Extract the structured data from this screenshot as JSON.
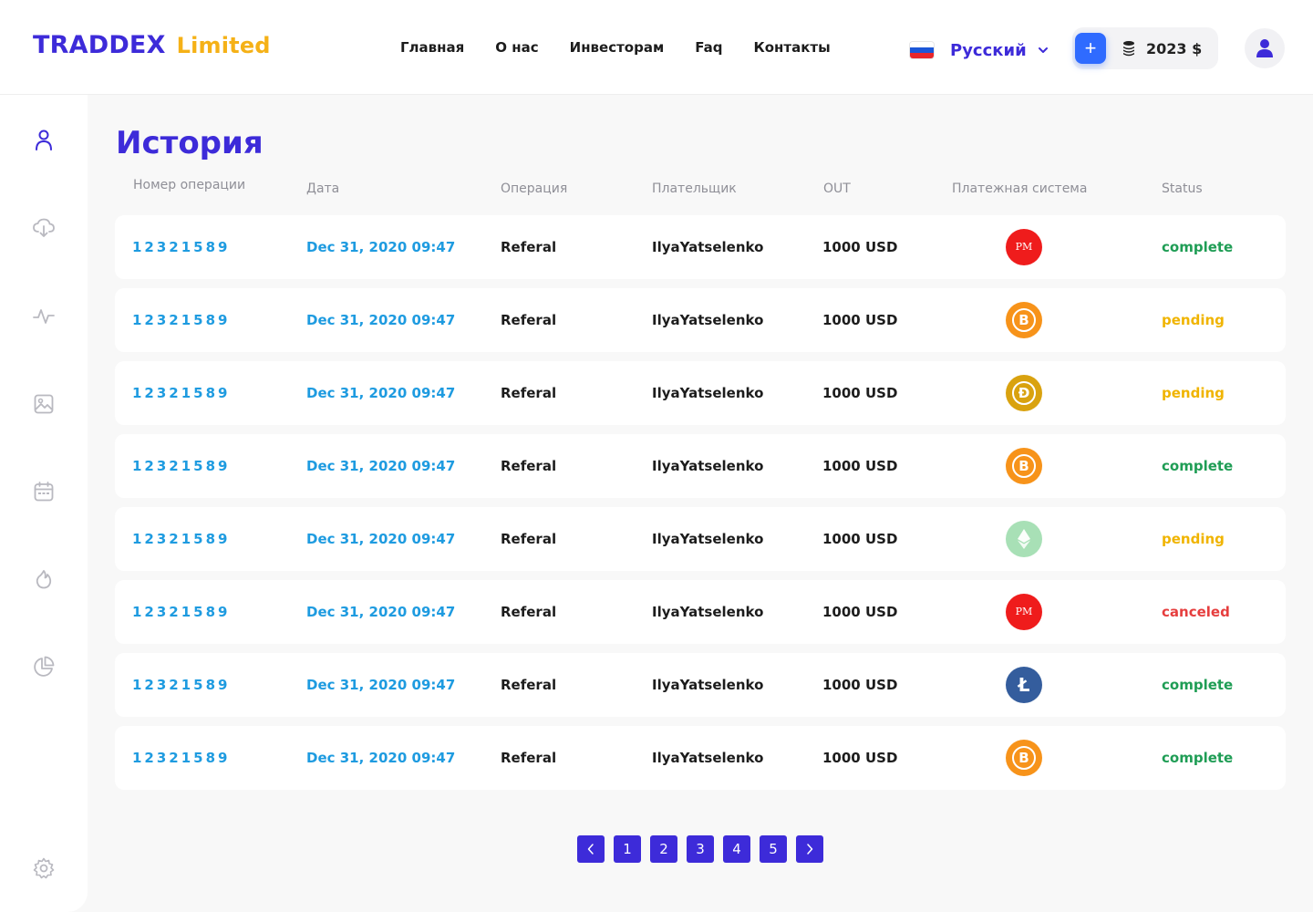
{
  "header": {
    "logo_brand": "TRADDEX",
    "logo_sub": "Limited",
    "nav": [
      "Главная",
      "О нас",
      "Инвесторам",
      "Faq",
      "Контакты"
    ],
    "language": "Русский",
    "add_label": "+",
    "balance": "2023 $"
  },
  "sidebar": {
    "icons": [
      "user-icon",
      "cloud-download-icon",
      "activity-icon",
      "image-icon",
      "calendar-icon",
      "fire-icon",
      "pie-chart-icon",
      "settings-icon"
    ]
  },
  "page": {
    "title": "История"
  },
  "table": {
    "columns": [
      "Номер операции",
      "Дата",
      "Операция",
      "Плательщик",
      "OUT",
      "Платежная система",
      "Status"
    ],
    "rows": [
      {
        "id": "12321589",
        "date": "Dec 31, 2020 09:47",
        "type": "Referal",
        "payer": "IlyaYatselenko",
        "out": "1000 USD",
        "pay": "perfect-money",
        "pay_label": "PM",
        "status": "complete"
      },
      {
        "id": "12321589",
        "date": "Dec 31, 2020 09:47",
        "type": "Referal",
        "payer": "IlyaYatselenko",
        "out": "1000 USD",
        "pay": "bitcoin",
        "pay_label": "B",
        "status": "pending"
      },
      {
        "id": "12321589",
        "date": "Dec 31, 2020 09:47",
        "type": "Referal",
        "payer": "IlyaYatselenko",
        "out": "1000 USD",
        "pay": "dogecoin",
        "pay_label": "Đ",
        "status": "pending"
      },
      {
        "id": "12321589",
        "date": "Dec 31, 2020 09:47",
        "type": "Referal",
        "payer": "IlyaYatselenko",
        "out": "1000 USD",
        "pay": "bitcoin",
        "pay_label": "B",
        "status": "complete"
      },
      {
        "id": "12321589",
        "date": "Dec 31, 2020 09:47",
        "type": "Referal",
        "payer": "IlyaYatselenko",
        "out": "1000 USD",
        "pay": "ethereum",
        "pay_label": "",
        "status": "pending"
      },
      {
        "id": "12321589",
        "date": "Dec 31, 2020 09:47",
        "type": "Referal",
        "payer": "IlyaYatselenko",
        "out": "1000 USD",
        "pay": "perfect-money",
        "pay_label": "PM",
        "status": "canceled"
      },
      {
        "id": "12321589",
        "date": "Dec 31, 2020 09:47",
        "type": "Referal",
        "payer": "IlyaYatselenko",
        "out": "1000 USD",
        "pay": "litecoin",
        "pay_label": "Ł",
        "status": "complete"
      },
      {
        "id": "12321589",
        "date": "Dec 31, 2020 09:47",
        "type": "Referal",
        "payer": "IlyaYatselenko",
        "out": "1000 USD",
        "pay": "bitcoin",
        "pay_label": "B",
        "status": "complete"
      }
    ]
  },
  "status_colors": {
    "complete": "#1f9d55",
    "pending": "#f0b400",
    "canceled": "#e63e3e"
  },
  "pay_colors": {
    "perfect-money": "#ef1c1c",
    "bitcoin": "#f7931a",
    "dogecoin": "#d9a20f",
    "ethereum": "#a8e0b6",
    "litecoin": "#345d9d"
  },
  "pagination": {
    "prev": "‹",
    "pages": [
      "1",
      "2",
      "3",
      "4",
      "5"
    ],
    "next": "›"
  }
}
